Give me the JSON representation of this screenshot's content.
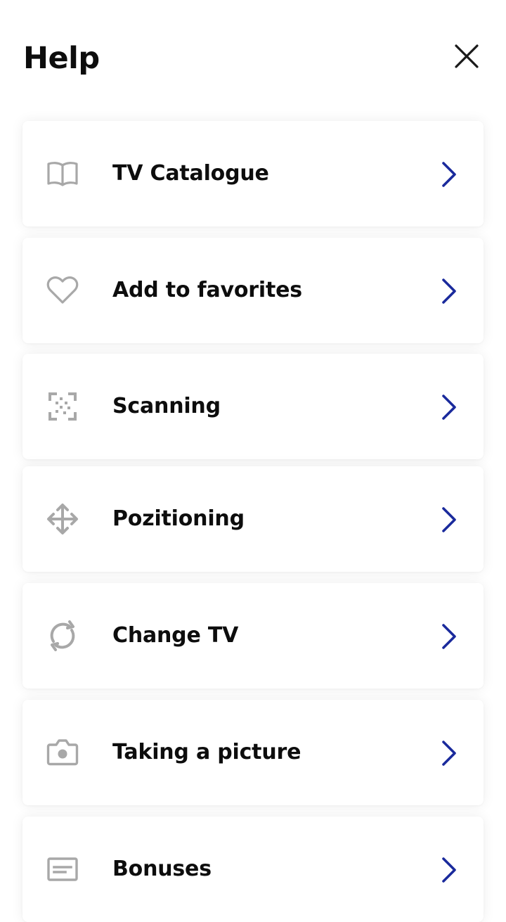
{
  "header": {
    "title": "Help",
    "close_icon": "close-icon"
  },
  "colors": {
    "accent": "#1a2a9c",
    "icon_gray": "#a8a8a8",
    "text": "#0d0d0d"
  },
  "items": [
    {
      "label": "TV Catalogue",
      "icon": "book-icon"
    },
    {
      "label": "Add to favorites",
      "icon": "heart-icon"
    },
    {
      "label": "Scanning",
      "icon": "scan-icon"
    },
    {
      "label": "Pozitioning",
      "icon": "move-icon"
    },
    {
      "label": "Change TV",
      "icon": "refresh-icon"
    },
    {
      "label": "Taking a picture",
      "icon": "camera-icon"
    },
    {
      "label": "Bonuses",
      "icon": "card-icon"
    }
  ]
}
